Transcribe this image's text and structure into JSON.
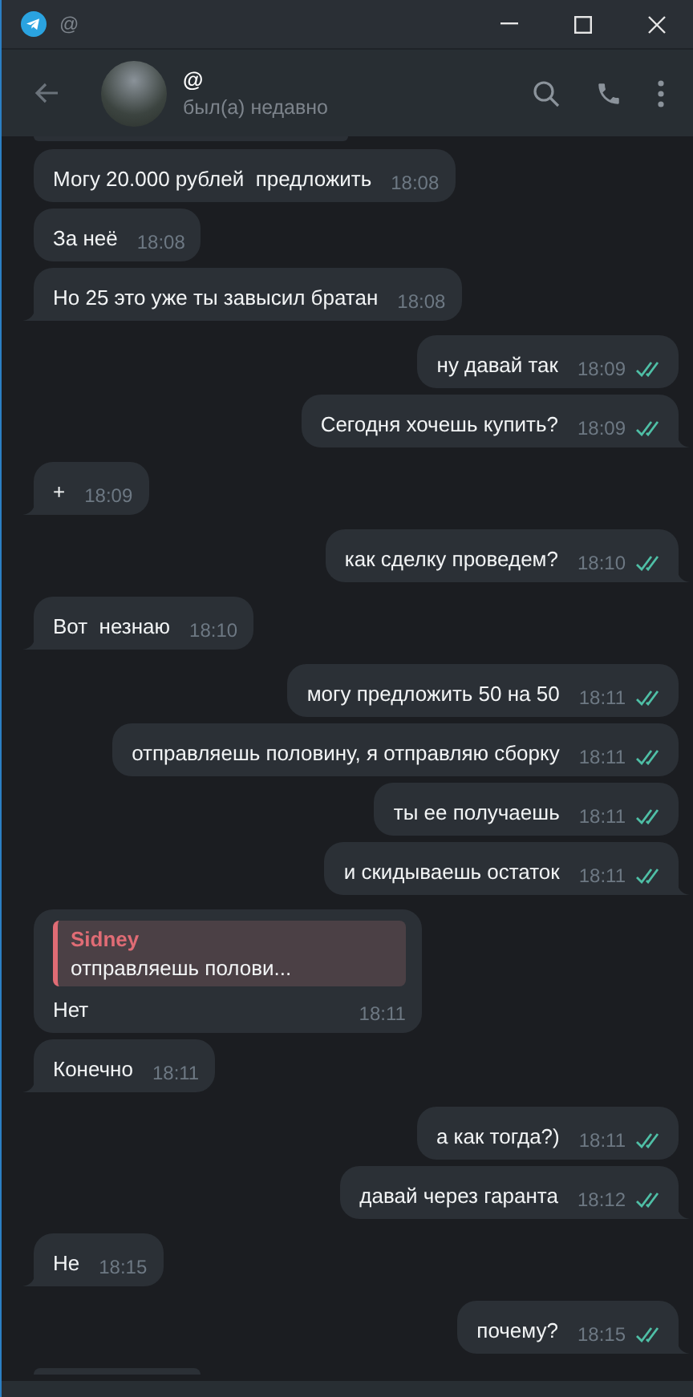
{
  "window": {
    "title": "@"
  },
  "header": {
    "name": "@",
    "status": "был(а) недавно"
  },
  "messages": [
    {
      "kind": "in",
      "text": "Могу 20.000 рублей  предложить",
      "time": "18:08"
    },
    {
      "kind": "in",
      "text": "За неё",
      "time": "18:08"
    },
    {
      "kind": "in",
      "text": "Но 25 это уже ты завысил братан",
      "time": "18:08"
    },
    {
      "kind": "out",
      "text": "ну давай так",
      "time": "18:09",
      "read": true
    },
    {
      "kind": "out",
      "text": "Сегодня хочешь купить?",
      "time": "18:09",
      "read": true
    },
    {
      "kind": "in",
      "text": "+",
      "time": "18:09"
    },
    {
      "kind": "out",
      "text": "как сделку проведем?",
      "time": "18:10",
      "read": true
    },
    {
      "kind": "in",
      "text": "Вот  незнаю",
      "time": "18:10"
    },
    {
      "kind": "out",
      "text": "могу предложить 50 на 50",
      "time": "18:11",
      "read": true
    },
    {
      "kind": "out",
      "text": "отправляешь половину, я отправляю сборку",
      "time": "18:11",
      "read": true
    },
    {
      "kind": "out",
      "text": "ты ее получаешь",
      "time": "18:11",
      "read": true
    },
    {
      "kind": "out",
      "text": "и скидываешь остаток",
      "time": "18:11",
      "read": true
    },
    {
      "kind": "in",
      "text": "Нет",
      "time": "18:11",
      "reply": {
        "author": "Sidney",
        "text": "отправляешь полови..."
      }
    },
    {
      "kind": "in",
      "text": "Конечно",
      "time": "18:11"
    },
    {
      "kind": "out",
      "text": "а как тогда?)",
      "time": "18:11",
      "read": true
    },
    {
      "kind": "out",
      "text": "давай через гаранта",
      "time": "18:12",
      "read": true
    },
    {
      "kind": "in",
      "text": "Не",
      "time": "18:15"
    },
    {
      "kind": "out",
      "text": "почему?",
      "time": "18:15",
      "read": true
    }
  ]
}
